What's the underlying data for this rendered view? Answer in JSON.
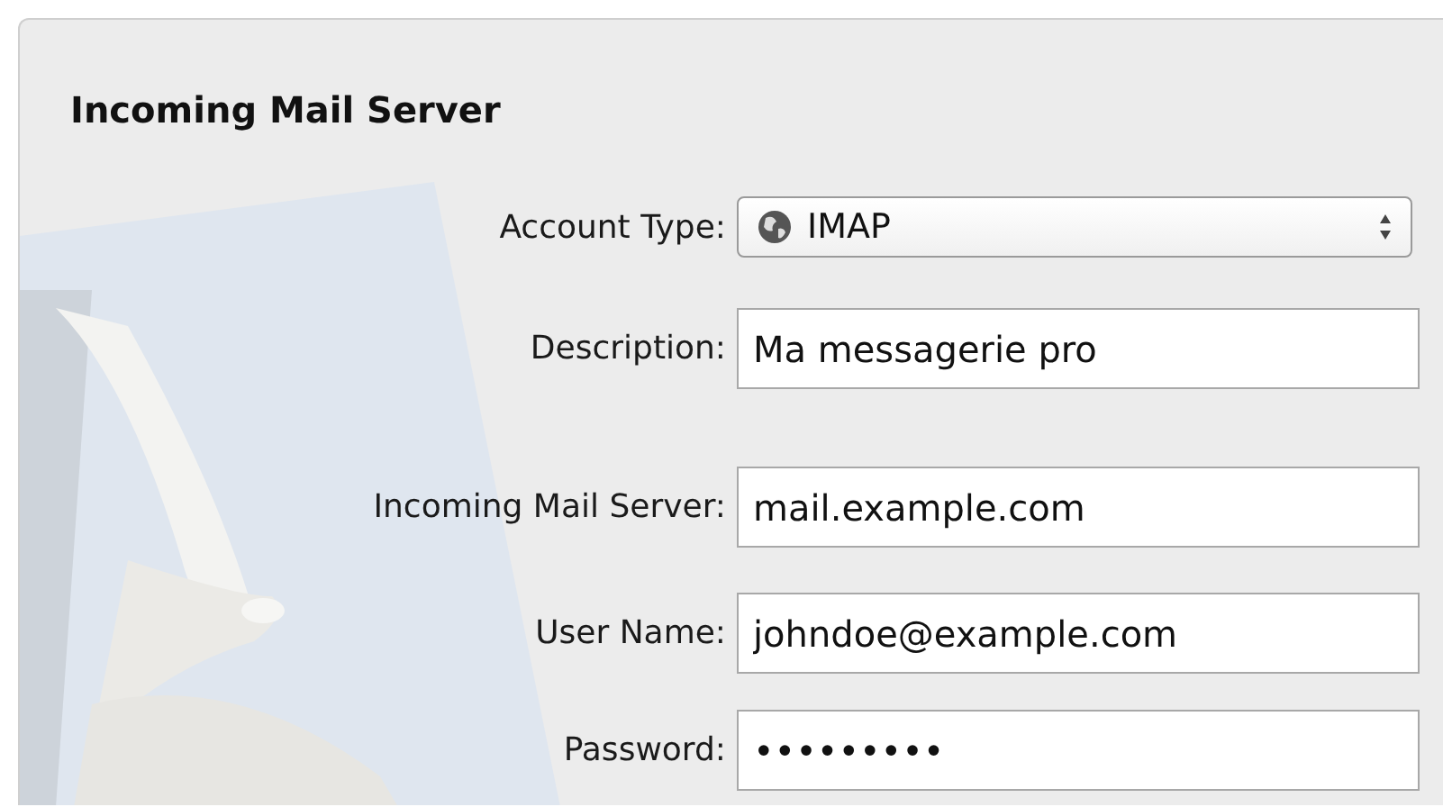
{
  "section": {
    "title": "Incoming Mail Server"
  },
  "fields": [
    {
      "kind": "select",
      "label": "Account Type:",
      "value": "IMAP"
    },
    {
      "kind": "text",
      "label": "Description:",
      "value": "Ma messagerie pro"
    },
    {
      "kind": "text",
      "label": "Incoming Mail Server:",
      "value": "mail.example.com"
    },
    {
      "kind": "text",
      "label": "User Name:",
      "value": "johndoe@example.com"
    },
    {
      "kind": "text",
      "label": "Password:",
      "value": "•••••••••"
    }
  ]
}
